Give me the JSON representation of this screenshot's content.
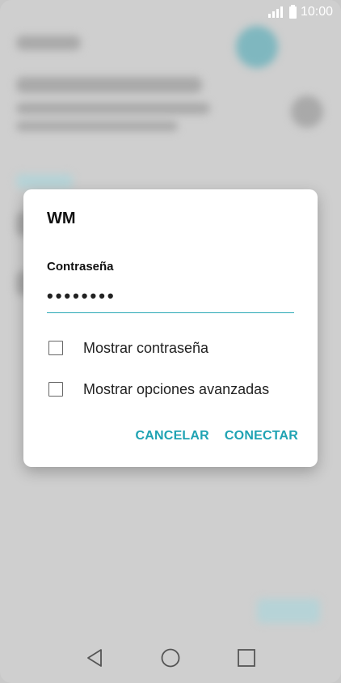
{
  "status_bar": {
    "time": "10:00",
    "icons": [
      "signal-icon",
      "battery-icon"
    ]
  },
  "dialog": {
    "title": "WM",
    "password_label": "Contraseña",
    "password_value": "••••••••",
    "options": [
      {
        "label": "Mostrar contraseña",
        "checked": false
      },
      {
        "label": "Mostrar opciones avanzadas",
        "checked": false
      }
    ],
    "cancel_label": "CANCELAR",
    "connect_label": "CONECTAR",
    "accent_color": "#1fa3b3"
  },
  "nav_bar": {
    "icons": [
      "back-icon",
      "home-icon",
      "recents-icon"
    ]
  }
}
